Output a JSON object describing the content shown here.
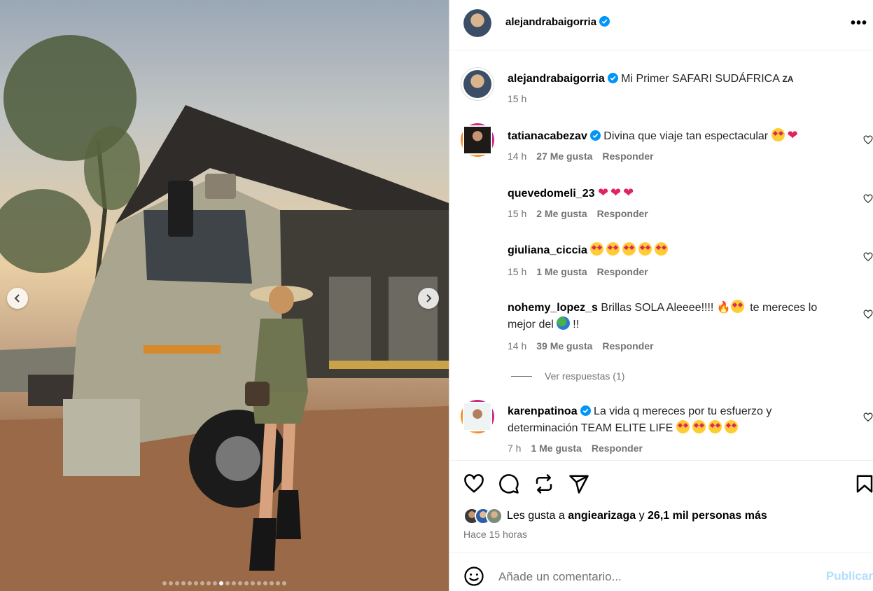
{
  "post": {
    "author": "alejandrabaigorria",
    "caption": "Mi Primer SAFARI SUDÁFRICA",
    "caption_flag": "ZA",
    "caption_time": "15 h"
  },
  "comments": [
    {
      "user": "tatianacabezav",
      "verified": true,
      "text": "Divina que viaje tan espectacular",
      "time": "14 h",
      "likes": "27 Me gusta",
      "reply": "Responder"
    },
    {
      "user": "quevedomeli_23",
      "verified": false,
      "text": "",
      "time": "15 h",
      "likes": "2 Me gusta",
      "reply": "Responder"
    },
    {
      "user": "giuliana_ciccia",
      "verified": false,
      "text": "",
      "time": "15 h",
      "likes": "1 Me gusta",
      "reply": "Responder"
    },
    {
      "user": "nohemy_lopez_s",
      "verified": false,
      "text": "Brillas SOLA Aleeee!!!!",
      "text2": "te mereces lo",
      "text3": "mejor del",
      "text4": "!!",
      "time": "14 h",
      "likes": "39 Me gusta",
      "reply": "Responder"
    },
    {
      "user": "karenpatinoa",
      "verified": true,
      "text": "La vida q mereces por tu esfuerzo y",
      "text2": "determinación TEAM ELITE LIFE",
      "time": "7 h",
      "likes": "1 Me gusta",
      "reply": "Responder"
    }
  ],
  "see_replies": "Ver respuestas (1)",
  "likes_line": {
    "prefix": "Les gusta a",
    "user": "angiearizaga",
    "connector": "y",
    "others": "26,1 mil personas más"
  },
  "time_ago": "Hace 15 horas",
  "composer": {
    "placeholder": "Añade un comentario...",
    "publish": "Publicar"
  },
  "carousel": {
    "total": 20,
    "active": 9
  },
  "colors": {
    "verified": "#0095f6",
    "publish": "#b2dffc",
    "muted": "#737373"
  },
  "icons": [
    "heart-icon",
    "comment-icon",
    "repost-icon",
    "share-icon",
    "bookmark-icon",
    "emoji-icon",
    "more-icon",
    "chevron-left-icon",
    "chevron-right-icon"
  ]
}
